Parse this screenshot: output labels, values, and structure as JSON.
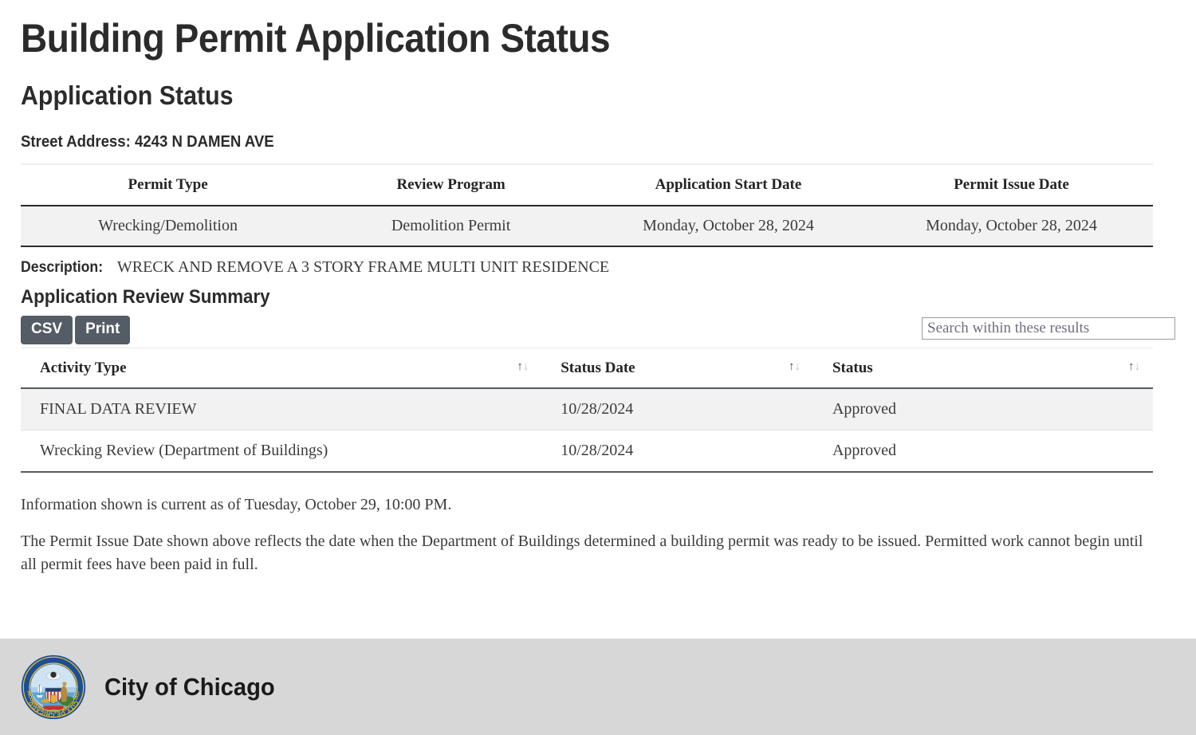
{
  "page": {
    "title": "Building Permit Application Status",
    "section_title": "Application Status",
    "street_address": "Street Address: 4243 N DAMEN AVE"
  },
  "permit_table": {
    "headers": [
      "Permit Type",
      "Review Program",
      "Application Start Date",
      "Permit Issue Date"
    ],
    "rows": [
      {
        "permit_type": "Wrecking/Demolition",
        "review_program": "Demolition Permit",
        "application_start_date": "Monday, October 28, 2024",
        "permit_issue_date": "Monday, October 28, 2024"
      }
    ]
  },
  "description": {
    "label": "Description:",
    "value": "WRECK AND REMOVE A 3 STORY FRAME MULTI UNIT RESIDENCE"
  },
  "review_summary": {
    "title": "Application Review Summary",
    "toolbar": {
      "csv_label": "CSV",
      "print_label": "Print",
      "search_placeholder": "Search within these results",
      "search_value": ""
    },
    "headers": [
      "Activity Type",
      "Status Date",
      "Status"
    ],
    "sort_icon": {
      "up": "↑",
      "down": "↓"
    },
    "rows": [
      {
        "activity_type": "FINAL DATA REVIEW",
        "status_date": "10/28/2024",
        "status": "Approved"
      },
      {
        "activity_type": "Wrecking Review (Department of Buildings)",
        "status_date": "10/28/2024",
        "status": "Approved"
      }
    ]
  },
  "notes": {
    "note_1": "Information shown is current as of Tuesday, October 29, 10:00 PM.",
    "note_2": "The Permit Issue Date shown above reflects the date when the Department of Buildings determined a building permit was ready to be issued. Permitted work cannot begin until all permit fees have been paid in full."
  },
  "footer": {
    "title": "City of Chicago",
    "seal": {
      "outer_text_top": "CITY OF CHICAGO",
      "outer_text_bottom": "INCORPORATED 4th MARCH 1837"
    }
  },
  "colors": {
    "button_bg": "#545c65",
    "row_alt_bg": "#f2f2f2",
    "footer_bg": "#d7d7d7",
    "text": "#3b3b3b",
    "heading": "#2b2b2b",
    "seal_ring": "#1b4f96",
    "seal_gold": "#f2c232"
  }
}
